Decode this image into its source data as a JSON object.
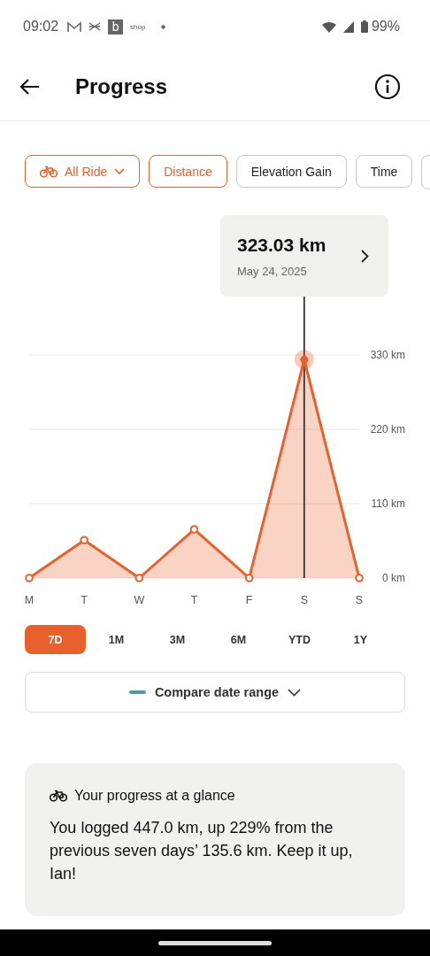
{
  "status_bar": {
    "time": "09:02",
    "notification_badge": "b",
    "notification_text": "shop",
    "battery": "99%"
  },
  "header": {
    "title": "Progress"
  },
  "activity_filter": {
    "label": "All Ride",
    "selected": true
  },
  "metrics": [
    {
      "label": "Distance",
      "selected": true
    },
    {
      "label": "Elevation Gain",
      "selected": false
    },
    {
      "label": "Time",
      "selected": false
    }
  ],
  "tooltip": {
    "value": "323.03 km",
    "date": "May 24, 2025"
  },
  "chart": {
    "points": [
      {
        "selected": false
      },
      {
        "selected": false
      },
      {
        "selected": false
      },
      {
        "selected": false
      },
      {
        "selected": false
      },
      {
        "selected": true
      },
      {
        "selected": false
      }
    ],
    "chart_data": {
      "type": "area",
      "categories": [
        "M",
        "T",
        "W",
        "T",
        "F",
        "S",
        "S"
      ],
      "series": [
        {
          "color": "#e8602c",
          "values": [
            0,
            56,
            0,
            72,
            0,
            323,
            0
          ]
        }
      ],
      "ref_lines": [
        {
          "axis": "x",
          "value": "S"
        }
      ],
      "ylim": [
        0,
        330
      ],
      "yticks": [
        {
          "value": 0,
          "label": "0 km"
        },
        {
          "value": 110,
          "label": "110 km"
        },
        {
          "value": 220,
          "label": "220 km"
        },
        {
          "value": 330,
          "label": "330 km"
        }
      ]
    }
  },
  "ranges": [
    {
      "label": "7D",
      "selected": true
    },
    {
      "label": "1M",
      "selected": false
    },
    {
      "label": "3M",
      "selected": false
    },
    {
      "label": "6M",
      "selected": false
    },
    {
      "label": "YTD",
      "selected": false
    },
    {
      "label": "1Y",
      "selected": false
    }
  ],
  "compare_button": {
    "label": "Compare date range"
  },
  "summary": {
    "title": "Your progress at a glance",
    "text": "You logged 447.0 km, up 229% from the previous seven days’ 135.6 km. Keep it up, Ian!"
  }
}
